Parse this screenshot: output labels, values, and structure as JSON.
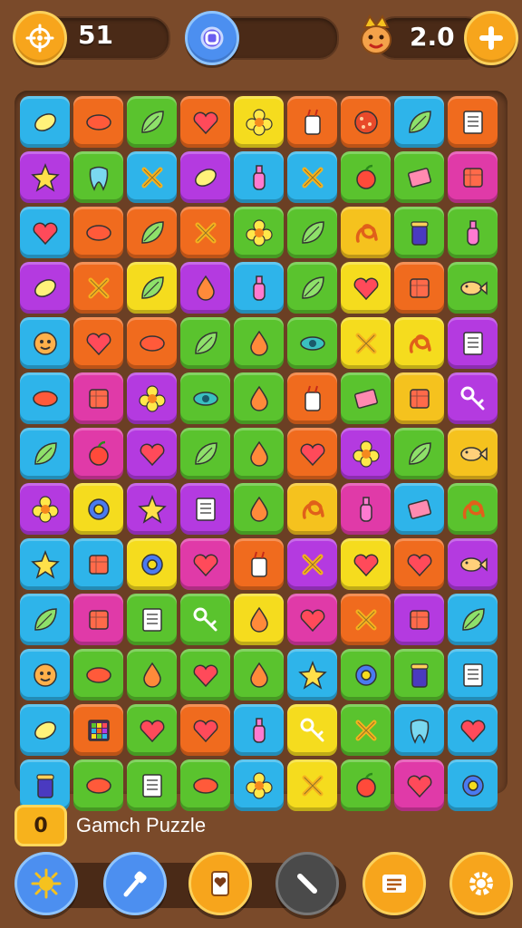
{
  "hud": {
    "moves": "51",
    "multiplier": "2.0"
  },
  "footer": {
    "coin_label": "0",
    "title": "Gamch Puzzle"
  },
  "board": {
    "rows": [
      [
        [
          "#2eb4ea",
          "lemon"
        ],
        [
          "#f06b1e",
          "bean"
        ],
        [
          "#5ac32e",
          "leaf"
        ],
        [
          "#f06b1e",
          "heart"
        ],
        [
          "#f5dc1e",
          "flower"
        ],
        [
          "#f06b1e",
          "drink"
        ],
        [
          "#f06b1e",
          "pizza"
        ],
        [
          "#2eb4ea",
          "leaf"
        ],
        [
          "#f06b1e",
          "doc"
        ]
      ],
      [
        [
          "#b43ae0",
          "star"
        ],
        [
          "#5ac32e",
          "tooth"
        ],
        [
          "#2eb4ea",
          "cross"
        ],
        [
          "#b43ae0",
          "lemon"
        ],
        [
          "#2eb4ea",
          "bottle"
        ],
        [
          "#2eb4ea",
          "cross"
        ],
        [
          "#5ac32e",
          "apple"
        ],
        [
          "#5ac32e",
          "book"
        ],
        [
          "#e03aa8",
          "box"
        ]
      ],
      [
        [
          "#2eb4ea",
          "heart"
        ],
        [
          "#f06b1e",
          "bean"
        ],
        [
          "#f06b1e",
          "leaf"
        ],
        [
          "#f06b1e",
          "cross"
        ],
        [
          "#5ac32e",
          "flower"
        ],
        [
          "#5ac32e",
          "leaf"
        ],
        [
          "#f5c21e",
          "knot"
        ],
        [
          "#5ac32e",
          "jar"
        ],
        [
          "#5ac32e",
          "bottle"
        ]
      ],
      [
        [
          "#b43ae0",
          "lemon"
        ],
        [
          "#f06b1e",
          "cross"
        ],
        [
          "#f5dc1e",
          "leaf"
        ],
        [
          "#b43ae0",
          "drop"
        ],
        [
          "#2eb4ea",
          "bottle"
        ],
        [
          "#5ac32e",
          "leaf"
        ],
        [
          "#f5dc1e",
          "heart"
        ],
        [
          "#f06b1e",
          "box"
        ],
        [
          "#5ac32e",
          "fish"
        ]
      ],
      [
        [
          "#2eb4ea",
          "face"
        ],
        [
          "#f06b1e",
          "heart"
        ],
        [
          "#f06b1e",
          "bean"
        ],
        [
          "#5ac32e",
          "leaf"
        ],
        [
          "#5ac32e",
          "drop"
        ],
        [
          "#5ac32e",
          "eye"
        ],
        [
          "#f5dc1e",
          "cross"
        ],
        [
          "#f5dc1e",
          "knot"
        ],
        [
          "#b43ae0",
          "doc"
        ]
      ],
      [
        [
          "#2eb4ea",
          "bean"
        ],
        [
          "#e03aa8",
          "box"
        ],
        [
          "#b43ae0",
          "flower"
        ],
        [
          "#5ac32e",
          "eye"
        ],
        [
          "#5ac32e",
          "drop"
        ],
        [
          "#f06b1e",
          "drink"
        ],
        [
          "#5ac32e",
          "book"
        ],
        [
          "#f5c21e",
          "box"
        ],
        [
          "#b43ae0",
          "key"
        ]
      ],
      [
        [
          "#2eb4ea",
          "leaf"
        ],
        [
          "#e03aa8",
          "apple"
        ],
        [
          "#b43ae0",
          "heart"
        ],
        [
          "#5ac32e",
          "leaf"
        ],
        [
          "#5ac32e",
          "drop"
        ],
        [
          "#f06b1e",
          "heart"
        ],
        [
          "#b43ae0",
          "flower"
        ],
        [
          "#5ac32e",
          "leaf"
        ],
        [
          "#f5c21e",
          "fish"
        ]
      ],
      [
        [
          "#b43ae0",
          "flower"
        ],
        [
          "#f5dc1e",
          "ring"
        ],
        [
          "#b43ae0",
          "star"
        ],
        [
          "#b43ae0",
          "doc"
        ],
        [
          "#5ac32e",
          "drop"
        ],
        [
          "#f5c21e",
          "knot"
        ],
        [
          "#e03aa8",
          "bottle"
        ],
        [
          "#2eb4ea",
          "book"
        ],
        [
          "#5ac32e",
          "knot"
        ]
      ],
      [
        [
          "#2eb4ea",
          "star"
        ],
        [
          "#2eb4ea",
          "box"
        ],
        [
          "#f5dc1e",
          "ring"
        ],
        [
          "#e03aa8",
          "heart"
        ],
        [
          "#f06b1e",
          "drink"
        ],
        [
          "#b43ae0",
          "cross"
        ],
        [
          "#f5dc1e",
          "heart"
        ],
        [
          "#f06b1e",
          "heart"
        ],
        [
          "#b43ae0",
          "fish"
        ]
      ],
      [
        [
          "#2eb4ea",
          "leaf"
        ],
        [
          "#e03aa8",
          "box"
        ],
        [
          "#5ac32e",
          "doc"
        ],
        [
          "#5ac32e",
          "key"
        ],
        [
          "#f5dc1e",
          "drop"
        ],
        [
          "#e03aa8",
          "heart"
        ],
        [
          "#f06b1e",
          "cross"
        ],
        [
          "#b43ae0",
          "box"
        ],
        [
          "#2eb4ea",
          "leaf"
        ]
      ],
      [
        [
          "#2eb4ea",
          "face"
        ],
        [
          "#5ac32e",
          "bean"
        ],
        [
          "#5ac32e",
          "drop"
        ],
        [
          "#5ac32e",
          "heart"
        ],
        [
          "#5ac32e",
          "drop"
        ],
        [
          "#2eb4ea",
          "star"
        ],
        [
          "#5ac32e",
          "ring"
        ],
        [
          "#5ac32e",
          "jar"
        ],
        [
          "#2eb4ea",
          "doc"
        ]
      ],
      [
        [
          "#2eb4ea",
          "lemon"
        ],
        [
          "#f06b1e",
          "grid"
        ],
        [
          "#5ac32e",
          "heart"
        ],
        [
          "#f06b1e",
          "heart"
        ],
        [
          "#2eb4ea",
          "bottle"
        ],
        [
          "#f5dc1e",
          "key"
        ],
        [
          "#5ac32e",
          "cross"
        ],
        [
          "#2eb4ea",
          "tooth"
        ],
        [
          "#2eb4ea",
          "heart"
        ]
      ],
      [
        [
          "#2eb4ea",
          "jar"
        ],
        [
          "#5ac32e",
          "bean"
        ],
        [
          "#5ac32e",
          "doc"
        ],
        [
          "#5ac32e",
          "bean"
        ],
        [
          "#2eb4ea",
          "flower"
        ],
        [
          "#f5dc1e",
          "cross"
        ],
        [
          "#5ac32e",
          "apple"
        ],
        [
          "#e03aa8",
          "heart"
        ],
        [
          "#2eb4ea",
          "ring"
        ]
      ]
    ]
  }
}
